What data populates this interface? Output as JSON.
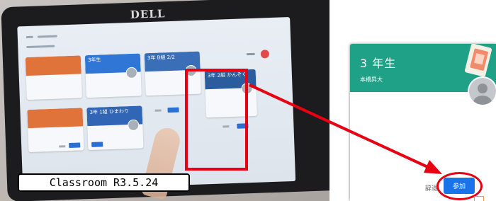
{
  "caption": {
    "text": "Classroom R3.5.24"
  },
  "tablet": {
    "brand_logo": "DELL",
    "class_cards": [
      {
        "title": "",
        "subtitle": "",
        "color": "#e0733a"
      },
      {
        "title": "3年生",
        "subtitle": "",
        "color": "#2f76d6"
      },
      {
        "title": "3年 B組 2/2",
        "subtitle": "",
        "color": "#3a6fb8"
      },
      {
        "title": "3年 2組 かんぞく",
        "subtitle": "",
        "color": "#2b5d9e"
      },
      {
        "title": "",
        "subtitle": "",
        "color": "#e0733a"
      },
      {
        "title": "3年 1組 ひまわり",
        "subtitle": "",
        "color": "#3066b5"
      }
    ],
    "icons": [
      "menu-icon",
      "profile-avatar"
    ]
  },
  "zoomed_card": {
    "title": "3 年生",
    "teacher": "本橋昇大",
    "decline_label": "辞退",
    "join_label": "参加",
    "header_color": "#1ea186",
    "join_color": "#1a73e8"
  },
  "annotation": {
    "highlight_color": "#e60012",
    "arrow_color": "#e60012"
  }
}
